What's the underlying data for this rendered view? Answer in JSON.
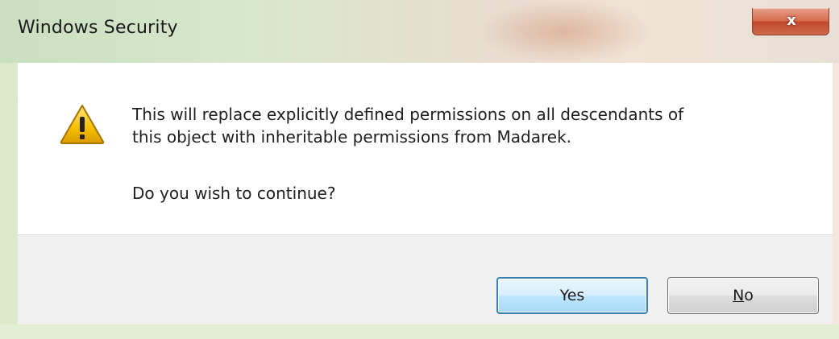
{
  "window": {
    "title": "Windows Security",
    "close_icon": "close-icon",
    "close_glyph": "x"
  },
  "message": {
    "icon": "warning-icon",
    "line1": "This will replace explicitly defined permissions on all descendants of",
    "line2": "this object with inheritable permissions from Madarek.",
    "question": "Do you wish to continue?"
  },
  "buttons": {
    "yes_label": "Yes",
    "no_label_accel": "N",
    "no_label_rest": "o"
  },
  "colors": {
    "accent_default_button": "#3c7fb1",
    "close_button": "#c0472c",
    "warning_fill": "#f5c000"
  }
}
